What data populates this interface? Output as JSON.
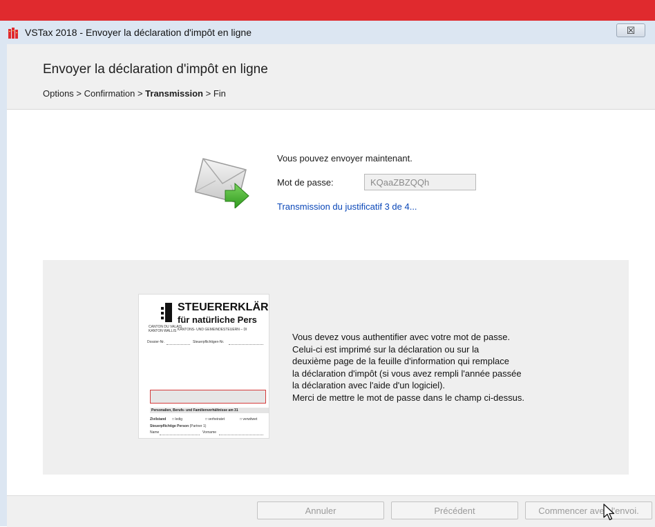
{
  "window": {
    "title": "VSTax 2018 - Envoyer la déclaration d'impôt en ligne",
    "close_glyph": "☒"
  },
  "header": {
    "title": "Envoyer la déclaration d'impôt en ligne",
    "breadcrumb": {
      "step1": "Options",
      "sep1": " > ",
      "step2": "Confirmation",
      "sep2": " > ",
      "step3": "Transmission",
      "sep3": " > ",
      "step4": "Fin"
    }
  },
  "status": {
    "send_text": "Vous pouvez envoyer maintenant.",
    "password_label": "Mot de passe:",
    "password_value": "KQaaZBZQQh",
    "progress_text": "Transmission du justificatif 3 de 4..."
  },
  "preview": {
    "title": "STEUERERKLÄR",
    "subtitle": "für natürliche Pers",
    "canton_line1": "CANTON DU VALAIS",
    "canton_line2": "KANTON WALLIS",
    "tax_line": "KANTONS- UND GEMEINDESTEUERN  –  DI",
    "dossier_label": "Dossier-Nr.",
    "taxpayer_no_label": "Steuerpflichtigen-Nr.",
    "section_title": "Personalien, Berufs- und Familienverhältnisse am 31",
    "civil_status_label": "Zivilstand",
    "opt_single": "ledig",
    "opt_married": "verheiratet",
    "opt_widowed": "verwitwet",
    "person_label": "Steuerpflichtige Person",
    "partner_label": "(Partner 1)",
    "name_label": "Name",
    "firstname_label": "Vorname"
  },
  "info": {
    "lines": [
      "Vous devez vous authentifier avec votre mot de passe.",
      "Celui-ci est imprimé sur la déclaration ou sur la",
      "deuxième page de la feuille d'information qui remplace",
      "la déclaration d'impôt (si vous avez rempli l'année passée",
      "la déclaration avec l'aide d'un logiciel).",
      "Merci de mettre le mot de passe dans le champ ci-dessus."
    ]
  },
  "buttons": {
    "cancel": "Annuler",
    "previous": "Précédent",
    "start": "Commencer avec l'envoi."
  },
  "colors": {
    "accent_red": "#e02a2e",
    "link_blue": "#0a47b8",
    "envelope_arrow_green": "#3fae2a"
  },
  "icons": {
    "app": "vstax-app-icon",
    "envelope": "envelope-send-icon",
    "cursor": "mouse-pointer-icon"
  }
}
